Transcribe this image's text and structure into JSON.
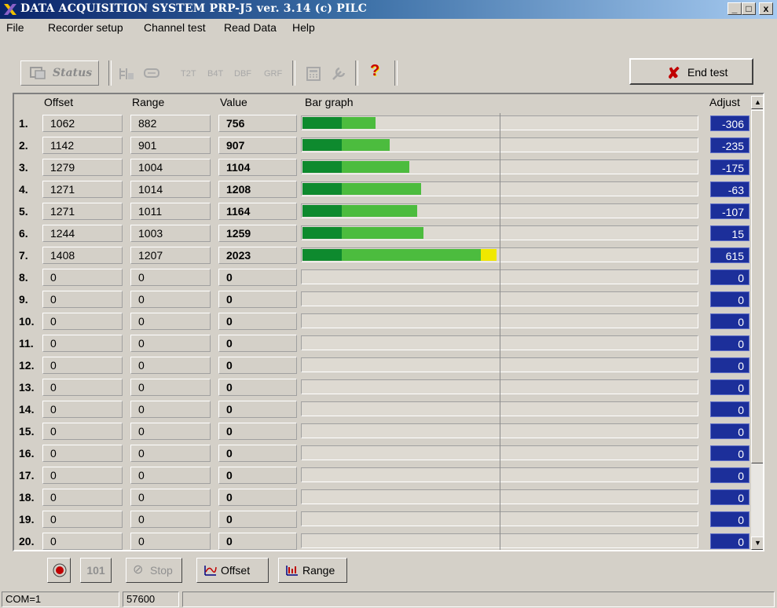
{
  "window": {
    "title": "DATA ACQUISITION SYSTEM  PRP-J5   ver. 3.14  (c) PILC",
    "controls": {
      "minimize": "_",
      "maximize": "□",
      "close": "x"
    }
  },
  "menu": [
    "File",
    "Recorder setup",
    "Channel test",
    "Read Data",
    "Help"
  ],
  "toolbar": {
    "status_label": "Status",
    "icons": [
      "channel-icon",
      "display-icon",
      "t2t-label",
      "b4t-label",
      "dbf-label",
      "grf-label",
      "calculator-icon",
      "wrench-icon"
    ],
    "small_labels": [
      "T2T",
      "B4T",
      "DBF",
      "GRF"
    ],
    "help_label": "?",
    "end_test_label": "End test",
    "end_test_underline": "E"
  },
  "table": {
    "headers": {
      "offset": "Offset",
      "range": "Range",
      "value": "Value",
      "bar": "Bar graph",
      "adjust": "Adjust"
    },
    "rows": [
      {
        "num": "1.",
        "offset": "1062",
        "range": "882",
        "value": "756",
        "adjust": "-306",
        "level": 0.37
      },
      {
        "num": "2.",
        "offset": "1142",
        "range": "901",
        "value": "907",
        "adjust": "-235",
        "level": 0.44
      },
      {
        "num": "3.",
        "offset": "1279",
        "range": "1004",
        "value": "1104",
        "adjust": "-175",
        "level": 0.54
      },
      {
        "num": "4.",
        "offset": "1271",
        "range": "1014",
        "value": "1208",
        "adjust": "-63",
        "level": 0.6
      },
      {
        "num": "5.",
        "offset": "1271",
        "range": "1011",
        "value": "1164",
        "adjust": "-107",
        "level": 0.58
      },
      {
        "num": "6.",
        "offset": "1244",
        "range": "1003",
        "value": "1259",
        "adjust": "15",
        "level": 0.61
      },
      {
        "num": "7.",
        "offset": "1408",
        "range": "1207",
        "value": "2023",
        "adjust": "615",
        "level": 0.98
      },
      {
        "num": "8.",
        "offset": "0",
        "range": "0",
        "value": "0",
        "adjust": "0",
        "level": 0
      },
      {
        "num": "9.",
        "offset": "0",
        "range": "0",
        "value": "0",
        "adjust": "0",
        "level": 0
      },
      {
        "num": "10.",
        "offset": "0",
        "range": "0",
        "value": "0",
        "adjust": "0",
        "level": 0
      },
      {
        "num": "11.",
        "offset": "0",
        "range": "0",
        "value": "0",
        "adjust": "0",
        "level": 0
      },
      {
        "num": "12.",
        "offset": "0",
        "range": "0",
        "value": "0",
        "adjust": "0",
        "level": 0
      },
      {
        "num": "13.",
        "offset": "0",
        "range": "0",
        "value": "0",
        "adjust": "0",
        "level": 0
      },
      {
        "num": "14.",
        "offset": "0",
        "range": "0",
        "value": "0",
        "adjust": "0",
        "level": 0
      },
      {
        "num": "15.",
        "offset": "0",
        "range": "0",
        "value": "0",
        "adjust": "0",
        "level": 0
      },
      {
        "num": "16.",
        "offset": "0",
        "range": "0",
        "value": "0",
        "adjust": "0",
        "level": 0
      },
      {
        "num": "17.",
        "offset": "0",
        "range": "0",
        "value": "0",
        "adjust": "0",
        "level": 0
      },
      {
        "num": "18.",
        "offset": "0",
        "range": "0",
        "value": "0",
        "adjust": "0",
        "level": 0
      },
      {
        "num": "19.",
        "offset": "0",
        "range": "0",
        "value": "0",
        "adjust": "0",
        "level": 0
      },
      {
        "num": "20.",
        "offset": "0",
        "range": "0",
        "value": "0",
        "adjust": "0",
        "level": 0
      }
    ]
  },
  "colors": {
    "bar_dark": "#0e8a2e",
    "bar_light": "#4cbc3e",
    "bar_over": "#f0e800",
    "adjust_bg": "#1c2f9a",
    "title_start": "#0a246a",
    "title_end": "#a6caf0"
  },
  "bottom": {
    "record_icon": "record-icon",
    "counter_label": "101",
    "stop_label": "Stop",
    "offset_label": "Offset",
    "range_label": "Range"
  },
  "statusbar": {
    "port": "COM=1",
    "baud": "57600"
  }
}
